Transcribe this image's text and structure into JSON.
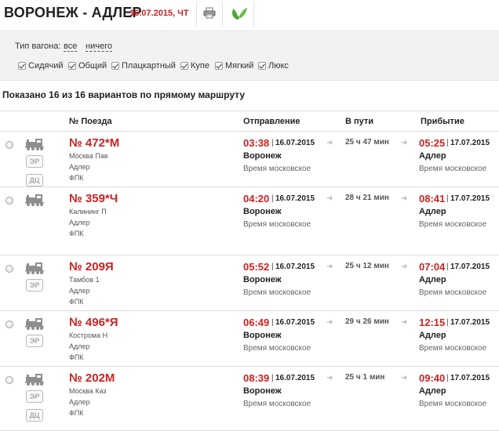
{
  "header": {
    "title": "ВОРОНЕЖ - АДЛЕР",
    "date": "16.07.2015, ЧТ",
    "print_icon": "printer-icon",
    "eco_icon": "green-leaves-icon"
  },
  "filter": {
    "label": "Тип вагона:",
    "all_link": "все",
    "none_link": "ничего",
    "car_types": [
      "Сидячий",
      "Общий",
      "Плацкартный",
      "Купе",
      "Мягкий",
      "Люкс"
    ]
  },
  "summary": "Показано 16 из 16 вариантов по прямому маршруту",
  "columns": {
    "train": "№ Поезда",
    "departure": "Отправление",
    "duration": "В пути",
    "arrival": "Прибытие"
  },
  "trains": [
    {
      "number": "№ 472*М",
      "from": "Москва Пав",
      "to": "Адлер",
      "carrier": "ФПК",
      "badges": [
        "ЭР",
        "ДЦ"
      ],
      "dep_time": "03:38",
      "dep_date": "16.07.2015",
      "dep_city": "Воронеж",
      "dep_tz": "Время московское",
      "duration": "25 ч 47 мин",
      "arr_time": "05:25",
      "arr_date": "17.07.2015",
      "arr_city": "Адлер",
      "arr_tz": "Время московское"
    },
    {
      "number": "№ 359*Ч",
      "from": "Калининг П",
      "to": "Адлер",
      "carrier": "ФПК",
      "badges": [],
      "dep_time": "04:20",
      "dep_date": "16.07.2015",
      "dep_city": "Воронеж",
      "dep_tz": "Время московское",
      "duration": "28 ч 21 мин",
      "arr_time": "08:41",
      "arr_date": "17.07.2015",
      "arr_city": "Адлер",
      "arr_tz": "Время московское"
    },
    {
      "number": "№ 209Я",
      "from": "Тамбов 1",
      "to": "Адлер",
      "carrier": "ФПК",
      "badges": [
        "ЭР"
      ],
      "dep_time": "05:52",
      "dep_date": "16.07.2015",
      "dep_city": "Воронеж",
      "dep_tz": "Время московское",
      "duration": "25 ч 12 мин",
      "arr_time": "07:04",
      "arr_date": "17.07.2015",
      "arr_city": "Адлер",
      "arr_tz": "Время московское"
    },
    {
      "number": "№ 496*Я",
      "from": "Кострома Н",
      "to": "Адлер",
      "carrier": "ФПК",
      "badges": [
        "ЭР"
      ],
      "dep_time": "06:49",
      "dep_date": "16.07.2015",
      "dep_city": "Воронеж",
      "dep_tz": "Время московское",
      "duration": "29 ч 26 мин",
      "arr_time": "12:15",
      "arr_date": "17.07.2015",
      "arr_city": "Адлер",
      "arr_tz": "Время московское"
    },
    {
      "number": "№ 202М",
      "from": "Москва Каз",
      "to": "Адлер",
      "carrier": "ФПК",
      "badges": [
        "ЭР",
        "ДЦ"
      ],
      "dep_time": "08:39",
      "dep_date": "16.07.2015",
      "dep_city": "Воронеж",
      "dep_tz": "Время московское",
      "duration": "25 ч 1 мин",
      "arr_time": "09:40",
      "arr_date": "17.07.2015",
      "arr_city": "Адлер",
      "arr_tz": "Время московское"
    }
  ],
  "colors": {
    "accent_red": "#cc2222",
    "panel_bg": "#f2f2f2",
    "border": "#dcdcdc"
  }
}
